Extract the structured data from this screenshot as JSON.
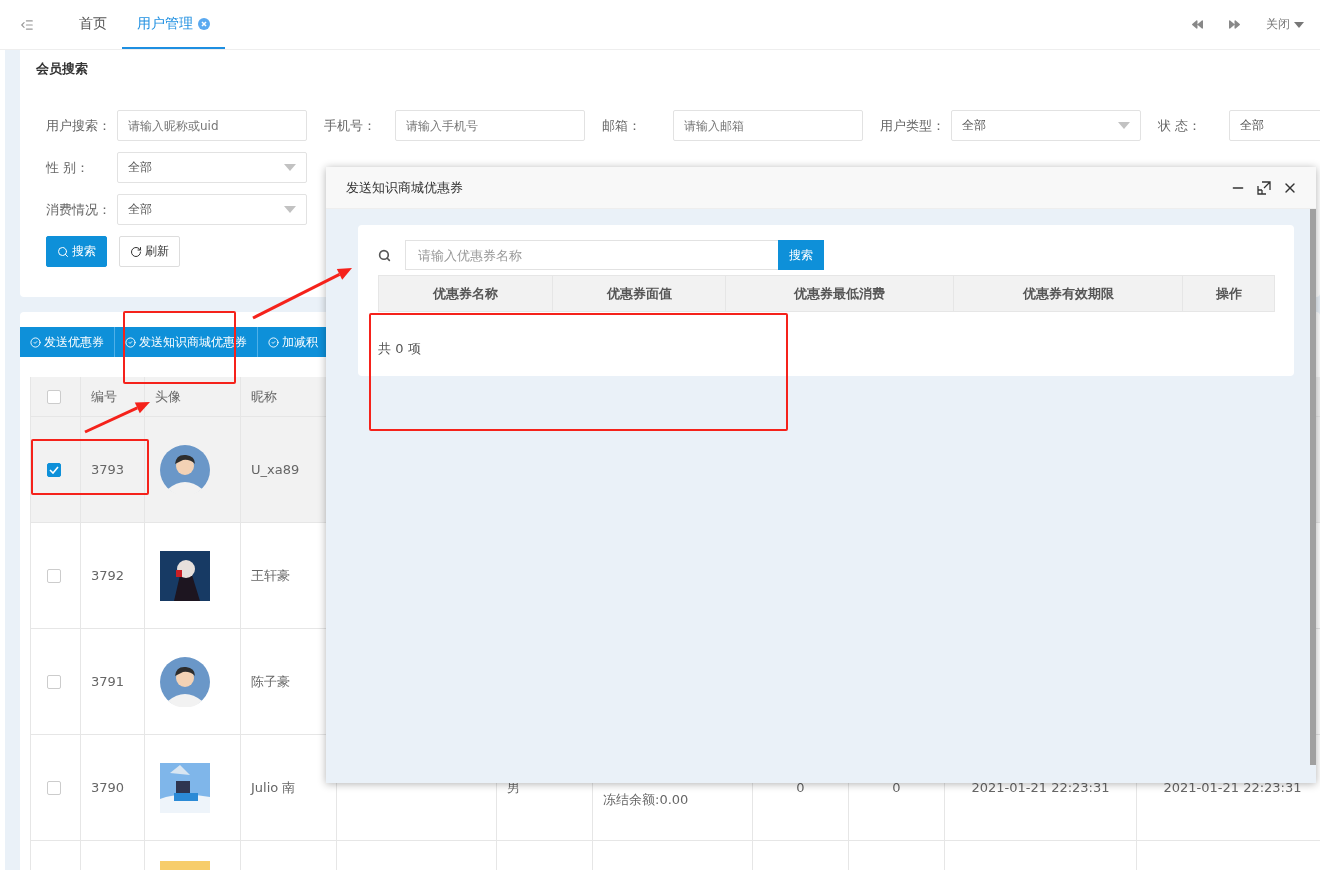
{
  "top_bar": {
    "tabs": [
      {
        "label": "首页",
        "selected": false,
        "closable": false
      },
      {
        "label": "用户管理",
        "selected": true,
        "closable": true
      }
    ],
    "close_menu": "关闭"
  },
  "search_card": {
    "title": "会员搜索",
    "rows": [
      [
        {
          "label": "用户搜索：",
          "kind": "input",
          "placeholder": "请输入昵称或uid"
        },
        {
          "label": "手机号：",
          "kind": "input",
          "placeholder": "请输入手机号"
        },
        {
          "label": "邮箱：",
          "kind": "input",
          "placeholder": "请输入邮箱"
        },
        {
          "label": "用户类型：",
          "kind": "select",
          "value": "全部"
        },
        {
          "label": "状 态：",
          "kind": "select",
          "value": "全部"
        }
      ],
      [
        {
          "label": "性 别：",
          "kind": "select",
          "value": "全部"
        }
      ],
      [
        {
          "label": "消费情况：",
          "kind": "select",
          "value": "全部"
        }
      ]
    ],
    "buttons": [
      {
        "label": "搜索",
        "kind": "primary"
      },
      {
        "label": "刷新",
        "kind": "default"
      }
    ]
  },
  "toolbar": [
    "发送优惠券",
    "发送知识商城优惠券",
    "加减积"
  ],
  "table": {
    "select_all": false,
    "columns": [
      "编号",
      "头像",
      "昵称"
    ],
    "rows": [
      {
        "checked": true,
        "selected": true,
        "id": "3793",
        "avatar": {
          "kind": "illustration"
        },
        "nickname": "U_xa89"
      },
      {
        "checked": false,
        "selected": false,
        "id": "3792",
        "nickname": "王轩豪"
      },
      {
        "checked": false,
        "selected": false,
        "id": "3791",
        "avatar": {
          "kind": "illustration"
        },
        "nickname": "陈子豪"
      },
      {
        "checked": false,
        "selected": false,
        "id": "3790",
        "nickname": "Julio 南",
        "gender": "男",
        "balance": "冻结余额:0.00",
        "count_1": "0",
        "count_2": "0",
        "time_1": "2021-01-21 22:23:31",
        "time_2": "2021-01-21 22:23:31"
      },
      {
        "selected": false
      }
    ]
  },
  "dialog": {
    "title": "发送知识商城优惠券",
    "search_placeholder": "请输入优惠券名称",
    "search_button": "搜索",
    "columns": [
      "优惠券名称",
      "优惠券面值",
      "优惠券最低消费",
      "优惠券有效期限",
      "操作"
    ],
    "total": "共 0 项"
  },
  "annotations": [
    {
      "kind": "box"
    },
    {
      "kind": "box"
    },
    {
      "kind": "box"
    },
    {
      "kind": "arrow"
    },
    {
      "kind": "arrow"
    }
  ]
}
